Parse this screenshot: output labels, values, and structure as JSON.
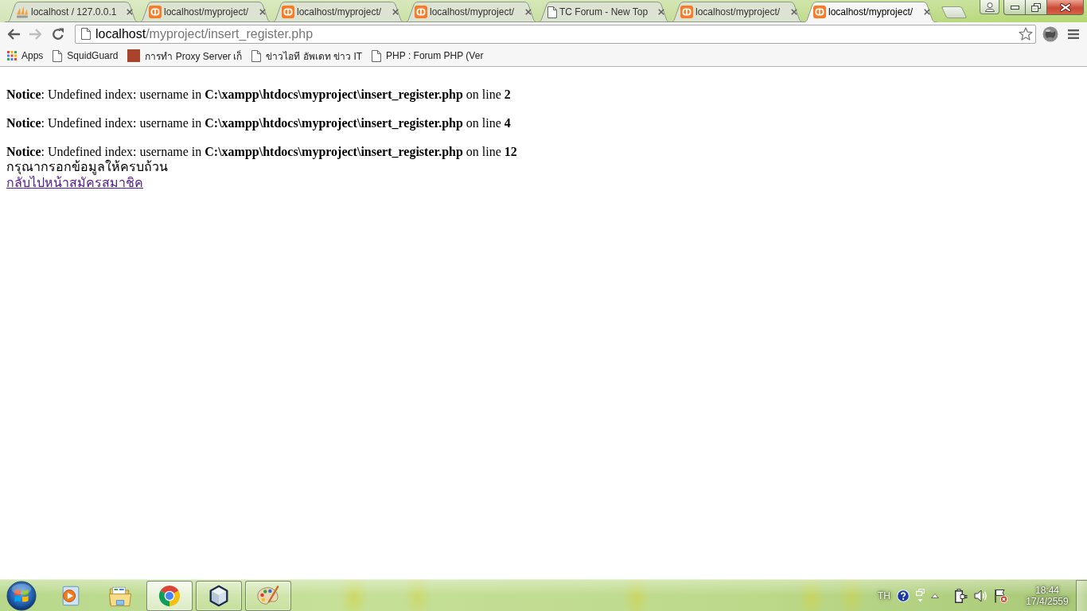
{
  "browser": {
    "tabs": [
      {
        "title": "localhost / 127.0.0.1",
        "kind": "sails",
        "selected": false
      },
      {
        "title": "localhost/myproject/",
        "kind": "tile",
        "selected": false
      },
      {
        "title": "localhost/myproject/",
        "kind": "tile",
        "selected": false
      },
      {
        "title": "localhost/myproject/",
        "kind": "tile",
        "selected": false
      },
      {
        "title": "TC Forum - New Top",
        "kind": "page",
        "selected": false
      },
      {
        "title": "localhost/myproject/",
        "kind": "tile",
        "selected": false
      },
      {
        "title": "localhost/myproject/",
        "kind": "tile",
        "selected": true
      }
    ],
    "navigation": [
      {
        "kind": "back",
        "disabled": false
      },
      {
        "kind": "forward",
        "disabled": true
      },
      {
        "kind": "reload",
        "disabled": false
      }
    ],
    "address": {
      "host": "localhost",
      "path": "/myproject/insert_register.php"
    },
    "bookmarks": [
      {
        "label": "Apps",
        "kind": "apps"
      },
      {
        "label": "SquidGuard",
        "kind": "page"
      },
      {
        "label": "การทำ Proxy Server เก็",
        "kind": "photo"
      },
      {
        "label": "ข่าวไอที อัพเดท ข่าว IT",
        "kind": "page"
      },
      {
        "label": "PHP : Forum PHP (Ver",
        "kind": "page"
      }
    ]
  },
  "page": {
    "notices": [
      "**Notice**: Undefined index: username in **C:\\xampp\\htdocs\\myproject\\insert_register.php** on line **2**",
      "**Notice**: Undefined index: username in **C:\\xampp\\htdocs\\myproject\\insert_register.php** on line **4**",
      "**Notice**: Undefined index: username in **C:\\xampp\\htdocs\\myproject\\insert_register.php** on line **12**"
    ],
    "message": "กรุณากรอกข้อมูลให้ครบถ้วน",
    "link": {
      "label": "กลับไปหน้าสมัครสมาชิค",
      "visited": true
    }
  },
  "taskbar": {
    "apps": [
      {
        "kind": "player",
        "running": false,
        "selected": false
      },
      {
        "kind": "folder",
        "running": false,
        "selected": false
      },
      {
        "kind": "browser",
        "running": true,
        "selected": true
      },
      {
        "kind": "cube",
        "running": true,
        "selected": false
      },
      {
        "kind": "palette",
        "running": true,
        "selected": false
      }
    ],
    "tray": {
      "language": "TH",
      "time": "18:44",
      "date": "17/4/2559"
    }
  }
}
